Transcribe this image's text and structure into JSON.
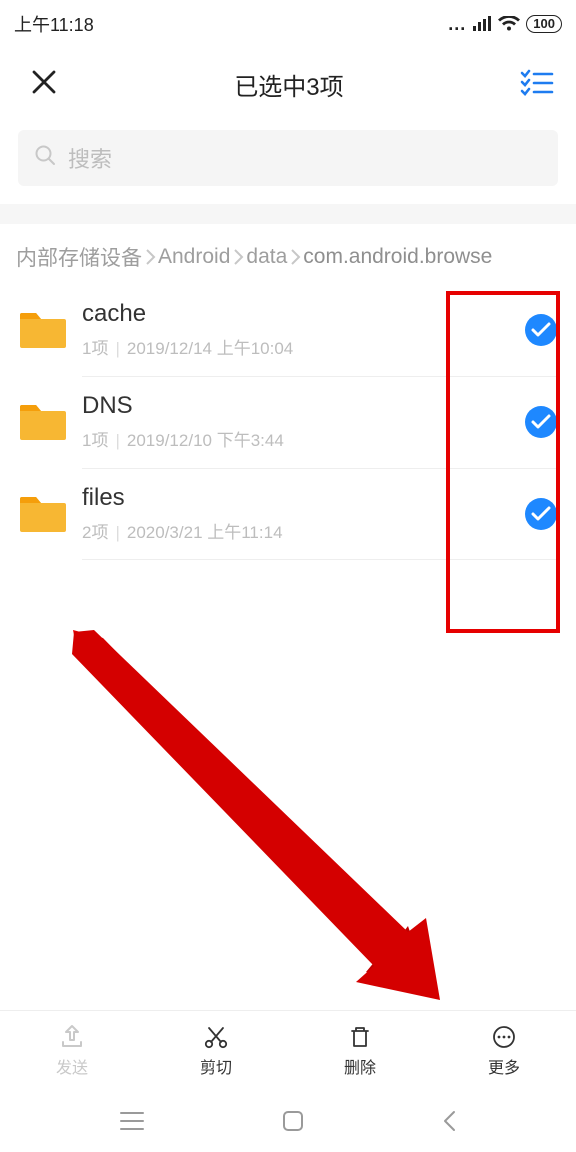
{
  "status": {
    "time": "上午11:18",
    "battery": "100"
  },
  "header": {
    "title": "已选中3项"
  },
  "search": {
    "placeholder": "搜索"
  },
  "breadcrumb": [
    "内部存储设备",
    "Android",
    "data",
    "com.android.browse"
  ],
  "folders": [
    {
      "name": "cache",
      "count": "1项",
      "date": "2019/12/14 上午10:04",
      "selected": true
    },
    {
      "name": "DNS",
      "count": "1项",
      "date": "2019/12/10 下午3:44",
      "selected": true
    },
    {
      "name": "files",
      "count": "2项",
      "date": "2020/3/21 上午11:14",
      "selected": true
    }
  ],
  "toolbar": {
    "send": "发送",
    "cut": "剪切",
    "delete": "删除",
    "more": "更多"
  }
}
